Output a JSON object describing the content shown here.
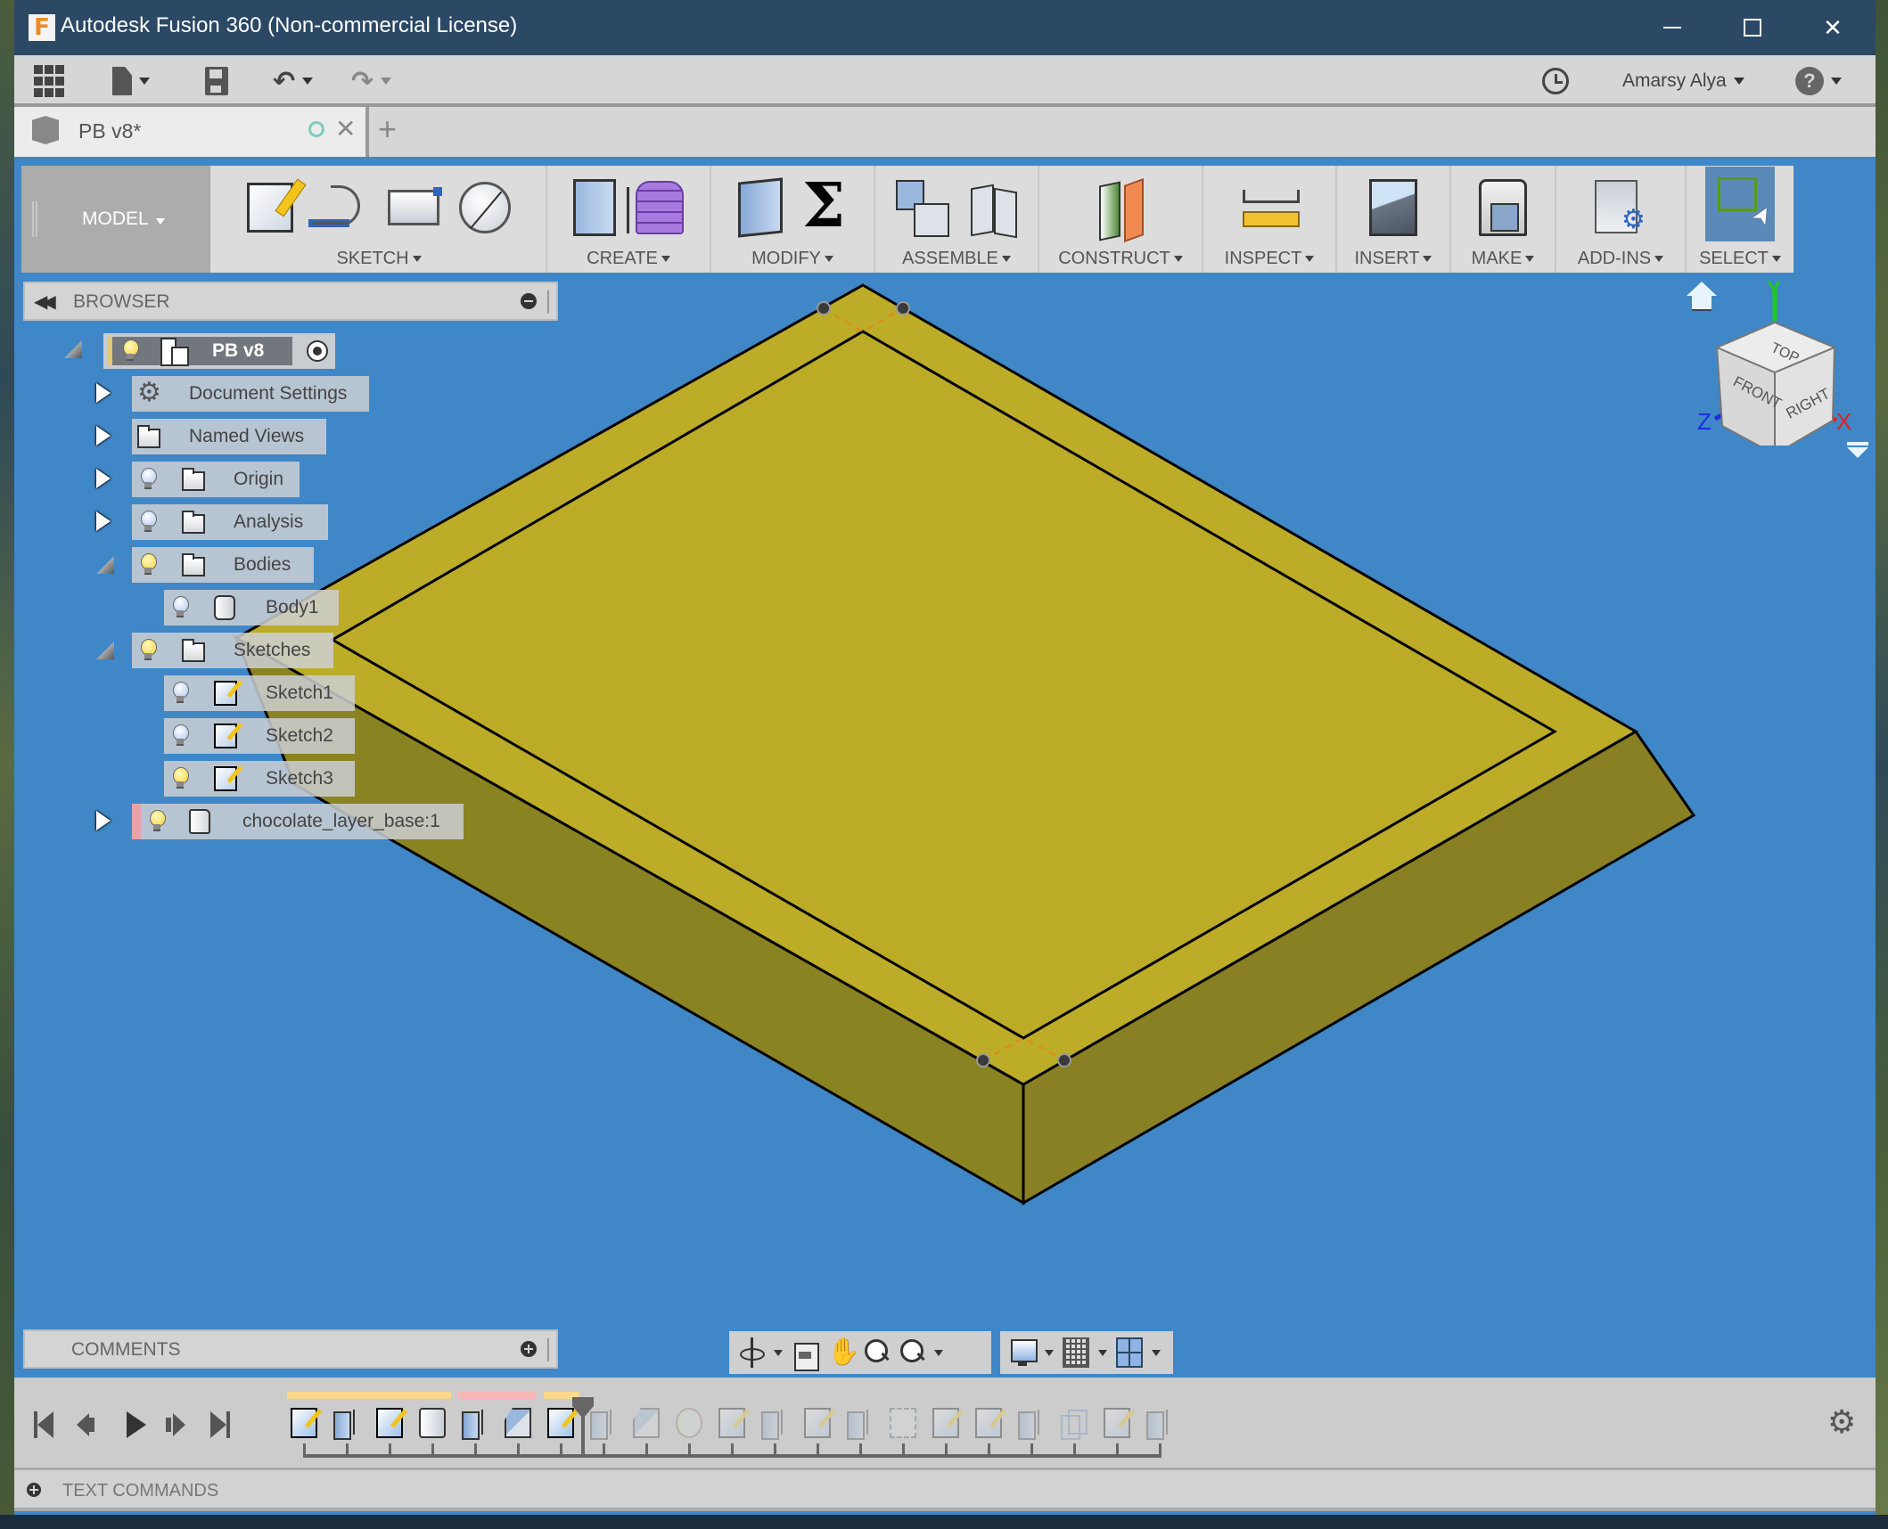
{
  "window": {
    "title": "Autodesk Fusion 360 (Non-commercial License)",
    "logo_letter": "F",
    "controls": [
      "minimize",
      "maximize",
      "close"
    ]
  },
  "quick_access": {
    "items": [
      "data-panel-grid-icon",
      "file-menu-icon",
      "save-icon",
      "undo-icon",
      "redo-icon"
    ],
    "user_name": "Amarsy Alya",
    "help_glyph": "?"
  },
  "document_tab": {
    "label": "PB v8*",
    "new_tab_glyph": "+"
  },
  "toolbar": {
    "workspace": "MODEL",
    "groups": [
      {
        "label": "SKETCH",
        "tools": [
          "create-sketch",
          "arc",
          "rectangle",
          "circle"
        ]
      },
      {
        "label": "CREATE",
        "tools": [
          "extrude",
          "create-form"
        ]
      },
      {
        "label": "MODIFY",
        "tools": [
          "press-pull",
          "parameters"
        ]
      },
      {
        "label": "ASSEMBLE",
        "tools": [
          "new-component",
          "joint"
        ]
      },
      {
        "label": "CONSTRUCT",
        "tools": [
          "offset-plane"
        ]
      },
      {
        "label": "INSPECT",
        "tools": [
          "measure"
        ]
      },
      {
        "label": "INSERT",
        "tools": [
          "attach-canvas"
        ]
      },
      {
        "label": "MAKE",
        "tools": [
          "3d-print"
        ]
      },
      {
        "label": "ADD-INS",
        "tools": [
          "scripts-and-add-ins"
        ]
      },
      {
        "label": "SELECT",
        "tools": [
          "select"
        ],
        "active": true
      }
    ]
  },
  "browser": {
    "title": "BROWSER",
    "root": {
      "label": "PB v8",
      "expanded": true,
      "visible": true
    },
    "items": [
      {
        "label": "Document Settings",
        "icon": "gear-icon",
        "expanded": false,
        "level": 1
      },
      {
        "label": "Named Views",
        "icon": "folder-icon",
        "expanded": false,
        "level": 1
      },
      {
        "label": "Origin",
        "icon": "folder-icon",
        "bulb": "off",
        "expanded": false,
        "level": 1
      },
      {
        "label": "Analysis",
        "icon": "folder-icon",
        "bulb": "off",
        "expanded": false,
        "level": 1
      },
      {
        "label": "Bodies",
        "icon": "folder-icon",
        "bulb": "on",
        "expanded": true,
        "level": 1
      },
      {
        "label": "Body1",
        "icon": "body-icon",
        "bulb": "off",
        "level": 2
      },
      {
        "label": "Sketches",
        "icon": "folder-icon",
        "bulb": "on",
        "expanded": true,
        "level": 1
      },
      {
        "label": "Sketch1",
        "icon": "sketch-icon",
        "bulb": "off",
        "level": 2
      },
      {
        "label": "Sketch2",
        "icon": "sketch-icon",
        "bulb": "off",
        "level": 2
      },
      {
        "label": "Sketch3",
        "icon": "sketch-icon",
        "bulb": "on",
        "level": 2
      },
      {
        "label": "chocolate_layer_base:1",
        "icon": "component-icon",
        "bulb": "on",
        "expanded": false,
        "level": 1,
        "linked": true
      }
    ]
  },
  "viewcube": {
    "faces": [
      "TOP",
      "FRONT",
      "RIGHT"
    ],
    "axes": {
      "x": "X",
      "y": "Y",
      "z": "Z"
    },
    "axis_colors": {
      "x": "#e0201c",
      "y": "#1ec81e",
      "z": "#1c2ee0"
    }
  },
  "comments": {
    "title": "COMMENTS"
  },
  "nav_toolbar": {
    "group1": [
      "orbit",
      "look-at",
      "pan",
      "zoom",
      "fit"
    ],
    "group2": [
      "display-settings",
      "grid-and-snaps",
      "viewports"
    ]
  },
  "timeline": {
    "controls": [
      "first",
      "previous",
      "play",
      "next",
      "last"
    ],
    "features": [
      {
        "type": "sketch",
        "active": true
      },
      {
        "type": "extrude",
        "active": true
      },
      {
        "type": "sketch",
        "active": true
      },
      {
        "type": "component",
        "active": true
      },
      {
        "type": "extrude",
        "active": true
      },
      {
        "type": "chamfer",
        "active": true
      },
      {
        "type": "sketch",
        "active": true
      },
      {
        "type": "extrude",
        "active": false
      },
      {
        "type": "chamfer",
        "active": false
      },
      {
        "type": "joint",
        "active": false
      },
      {
        "type": "sketch",
        "active": false
      },
      {
        "type": "extrude",
        "active": false
      },
      {
        "type": "sketch",
        "active": false
      },
      {
        "type": "extrude",
        "active": false
      },
      {
        "type": "pattern",
        "active": false
      },
      {
        "type": "sketch",
        "active": false
      },
      {
        "type": "sketch",
        "active": false
      },
      {
        "type": "extrude",
        "active": false
      },
      {
        "type": "combine",
        "active": false
      },
      {
        "type": "sketch",
        "active": false
      },
      {
        "type": "extrude",
        "active": false
      }
    ],
    "groups": [
      {
        "start": 0,
        "end": 3,
        "color": "#fcd88a"
      },
      {
        "start": 4,
        "end": 5,
        "color": "#f9b6b6"
      },
      {
        "start": 6,
        "end": 6,
        "color": "#fcd88a"
      }
    ],
    "marker_after_feature": 7
  },
  "text_commands": {
    "title": "TEXT COMMANDS"
  },
  "colors": {
    "canvas": "#3f87c7",
    "titlebar": "#2b4864",
    "model_top": "#bdac27",
    "model_side": "#8a8322",
    "model_side_right": "#888022"
  }
}
